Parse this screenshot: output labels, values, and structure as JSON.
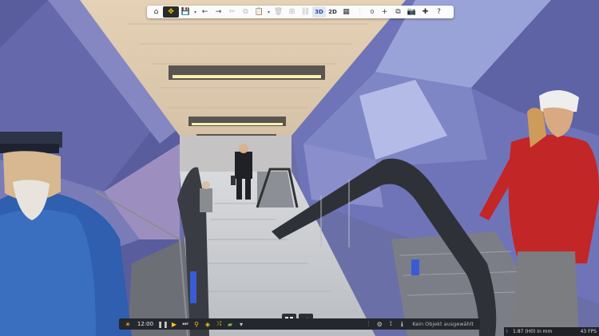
{
  "toolbar": {
    "items": [
      {
        "icon": "home-icon",
        "glyph": "⌂"
      },
      {
        "icon": "select-tool-icon",
        "glyph": "✥",
        "active": true
      },
      {
        "icon": "save-icon",
        "glyph": "💾"
      },
      {
        "icon": "chevron-down-icon",
        "glyph": "▾",
        "small": true
      },
      {
        "icon": "undo-icon",
        "glyph": "←"
      },
      {
        "icon": "redo-icon",
        "glyph": "→"
      },
      {
        "icon": "cut-icon",
        "glyph": "✂",
        "disabled": true
      },
      {
        "icon": "copy-icon",
        "glyph": "⧉",
        "disabled": true
      },
      {
        "icon": "paste-icon",
        "glyph": "📋",
        "disabled": true
      },
      {
        "icon": "chevron-down-icon",
        "glyph": "▾",
        "small": true
      },
      {
        "icon": "delete-icon",
        "glyph": "🗑",
        "disabled": true
      },
      {
        "icon": "group-icon",
        "glyph": "⊞",
        "disabled": true
      },
      {
        "icon": "link-icon",
        "glyph": "⛓",
        "disabled": true
      },
      {
        "label": "3D",
        "selected": true
      },
      {
        "label": "2D"
      },
      {
        "icon": "grid-icon",
        "glyph": "▦"
      },
      {
        "icon": "align-icon",
        "glyph": "⫶",
        "disabled": true
      },
      {
        "counter": "0"
      },
      {
        "icon": "add-icon",
        "glyph": "+"
      },
      {
        "icon": "layers-icon",
        "glyph": "⧉"
      },
      {
        "icon": "camera-icon",
        "glyph": "📷"
      },
      {
        "icon": "plugin-icon",
        "glyph": "✚"
      },
      {
        "icon": "help-icon",
        "glyph": "?"
      }
    ]
  },
  "bottombar": {
    "time": "12:00",
    "status_text": "Kein Objekt ausgewählt",
    "left_items": [
      {
        "icon": "sun-icon",
        "glyph": "☀",
        "cls": "sun"
      },
      {
        "time": true
      },
      {
        "icon": "pause-icon",
        "glyph": "❚❚"
      },
      {
        "icon": "play-icon",
        "glyph": "▶",
        "cls": "play"
      },
      {
        "icon": "skip-forward-icon",
        "glyph": "⏭"
      },
      {
        "icon": "search-icon",
        "glyph": "⚲",
        "cls": "play"
      },
      {
        "icon": "layers-icon",
        "glyph": "◈",
        "cls": "play"
      },
      {
        "icon": "shuffle-icon",
        "glyph": "⤨",
        "cls": "play"
      },
      {
        "icon": "terrain-icon",
        "glyph": "▰",
        "cls": "green"
      },
      {
        "icon": "chevron-down-icon",
        "glyph": "▾"
      }
    ],
    "right_items": [
      {
        "icon": "sliders-icon",
        "glyph": "⫶"
      },
      {
        "icon": "settings-icon",
        "glyph": "⚙"
      },
      {
        "icon": "walk-icon",
        "glyph": "⟟"
      },
      {
        "icon": "info-icon",
        "glyph": "ℹ"
      }
    ]
  },
  "view_switch": [
    {
      "icon": "grid-view-icon"
    },
    {
      "icon": "terrain-view-icon"
    }
  ],
  "statusbar": {
    "info_glyph": "i",
    "scale": "1:87 (H0) in mm",
    "fps": "43 FPS"
  },
  "colors": {
    "toolbar_bg": "#fbfbfb",
    "active_tool_bg": "#2b2b2b",
    "accent_yellow": "#f5d000",
    "bottombar_bg": "#24272e"
  }
}
